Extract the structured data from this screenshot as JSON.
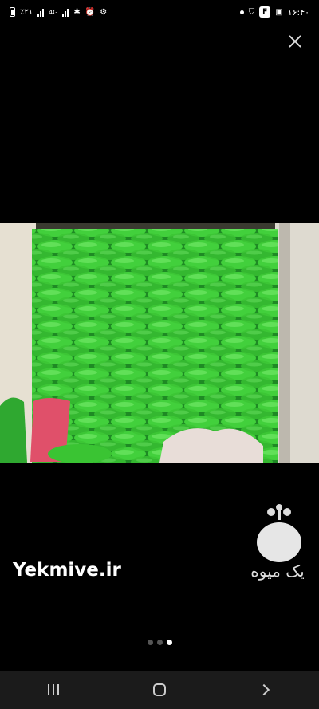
{
  "status_bar": {
    "battery_percent": "٪۲۱",
    "network_type": "4G",
    "time": "۱۶:۴۰",
    "notification_badge": "F",
    "icons_left": [
      "battery-icon",
      "signal-icon",
      "network-4g-icon",
      "signal-icon",
      "bluetooth-icon",
      "alarm-icon",
      "settings-icon"
    ],
    "icons_right": [
      "dot-icon",
      "shield-icon",
      "f-app-icon",
      "gallery-icon"
    ]
  },
  "viewer": {
    "close_icon": "close-icon",
    "image_subject": "green sacks stacked"
  },
  "watermark": {
    "site": "Yekmive.ir",
    "brand_fa": "یک میوه",
    "logo_icon": "apple-logo-icon"
  },
  "pager": {
    "total": 3,
    "current": 3
  },
  "nav": {
    "recent_icon": "recent-apps-icon",
    "home_icon": "home-icon",
    "back_icon": "back-icon"
  },
  "colors": {
    "background": "#000000",
    "sack_green": "#3fcf3a",
    "navbar": "#1b1b1b"
  }
}
